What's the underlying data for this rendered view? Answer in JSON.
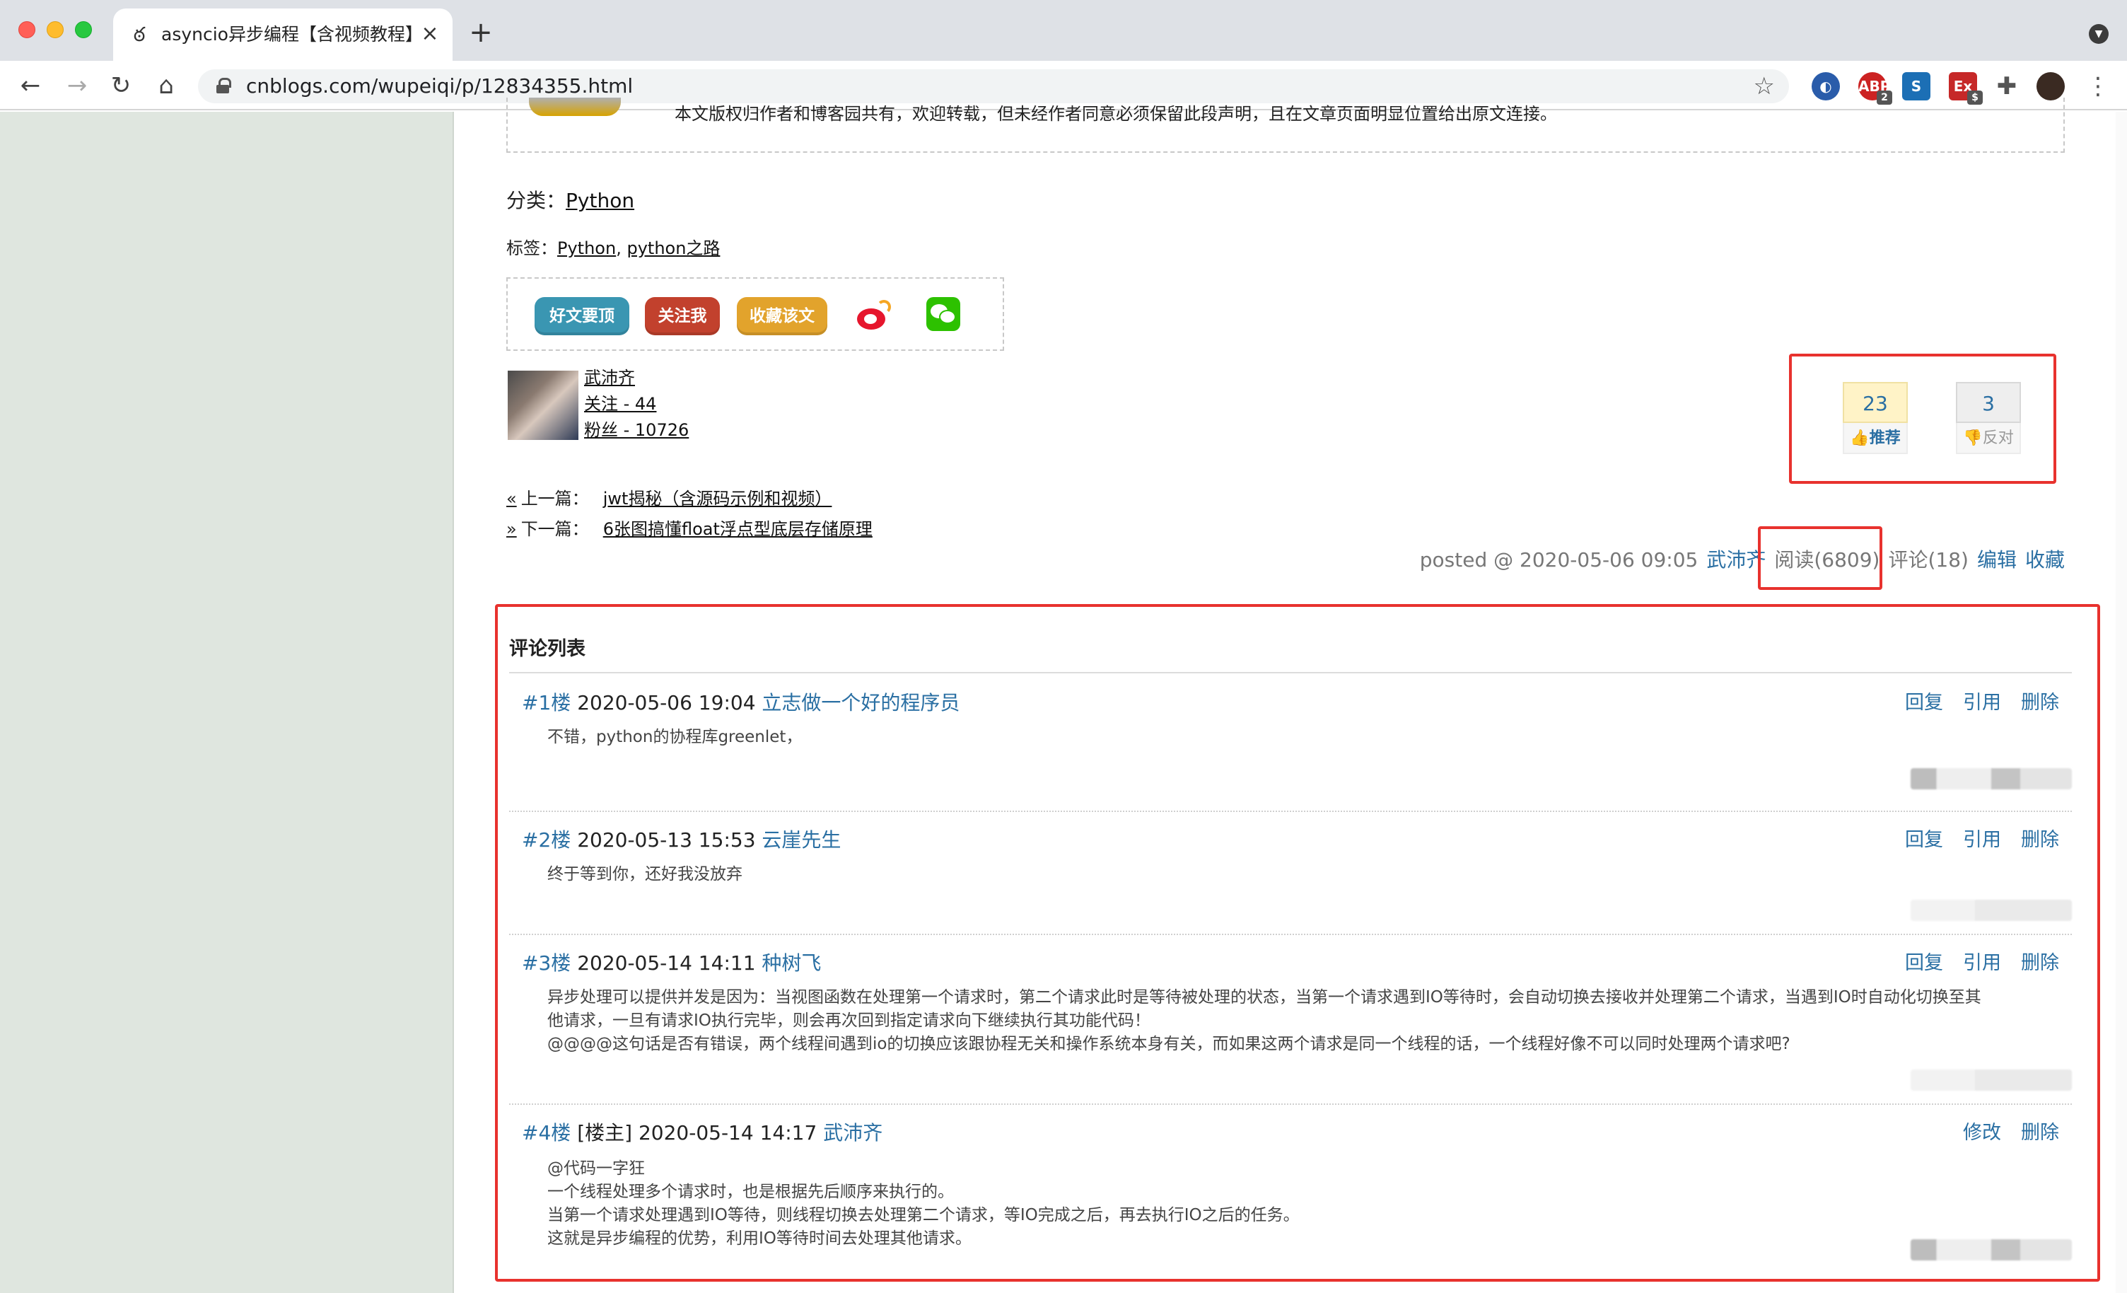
{
  "browser": {
    "tab_title": "asyncio异步编程【含视频教程】",
    "url": "cnblogs.com/wupeiqi/p/12834355.html",
    "ext_badges": [
      "2",
      "$"
    ]
  },
  "post": {
    "copyright_notice": "本文版权归作者和博客园共有，欢迎转载，但未经作者同意必须保留此段声明，且在文章页面明显位置给出原文连接。",
    "category_label": "分类：",
    "category": "Python",
    "tags_label": "标签：",
    "tags": [
      "Python",
      "python之路"
    ],
    "share_buttons": {
      "recommend": "好文要顶",
      "follow": "关注我",
      "favorite": "收藏该文"
    },
    "author": {
      "name": "武沛齐",
      "following": "关注 - 44",
      "followers": "粉丝 - 10726"
    },
    "nav": {
      "prev_label": "上一篇：",
      "prev_title": "jwt揭秘（含源码示例和视频）",
      "next_label": "下一篇：",
      "next_title": "6张图搞懂float浮点型底层存储原理"
    },
    "votes": {
      "up_count": "23",
      "up_label": "推荐",
      "down_count": "3",
      "down_label": "反对"
    },
    "footer": {
      "posted": "posted @ 2020-05-06 09:05",
      "author": "武沛齐",
      "reads": "阅读(6809)",
      "comments": "评论(18)",
      "edit": "编辑",
      "collect": "收藏"
    }
  },
  "comments": {
    "title": "评论列表",
    "items": [
      {
        "floor": "#1楼",
        "tag": "",
        "date": "2020-05-06 19:04",
        "author": "立志做一个好的程序员",
        "lines": [
          "不错，python的协程库greenlet，"
        ],
        "actions": [
          "回复",
          "引用",
          "删除"
        ]
      },
      {
        "floor": "#2楼",
        "tag": "",
        "date": "2020-05-13 15:53",
        "author": "云崖先生",
        "lines": [
          "终于等到你，还好我没放弃"
        ],
        "actions": [
          "回复",
          "引用",
          "删除"
        ]
      },
      {
        "floor": "#3楼",
        "tag": "",
        "date": "2020-05-14 14:11",
        "author": "种树飞",
        "lines": [
          "异步处理可以提供并发是因为：当视图函数在处理第一个请求时，第二个请求此时是等待被处理的状态，当第一个请求遇到IO等待时，会自动切换去接收并处理第二个请求，当遇到IO时自动化切换至其",
          "他请求，一旦有请求IO执行完毕，则会再次回到指定请求向下继续执行其功能代码！",
          "@@@@这句话是否有错误，两个线程间遇到io的切换应该跟协程无关和操作系统本身有关，而如果这两个请求是同一个线程的话，一个线程好像不可以同时处理两个请求吧?"
        ],
        "actions": [
          "回复",
          "引用",
          "删除"
        ]
      },
      {
        "floor": "#4楼",
        "tag": "[楼主]",
        "date": "2020-05-14 14:17",
        "author": "武沛齐",
        "lines": [
          "@代码一字狂",
          "一个线程处理多个请求时，也是根据先后顺序来执行的。",
          "当第一个请求处理遇到IO等待，则线程切换去处理第二个请求，等IO完成之后，再去执行IO之后的任务。",
          "这就是异步编程的优势，利用IO等待时间去处理其他请求。"
        ],
        "actions": [
          "修改",
          "删除"
        ]
      }
    ]
  }
}
